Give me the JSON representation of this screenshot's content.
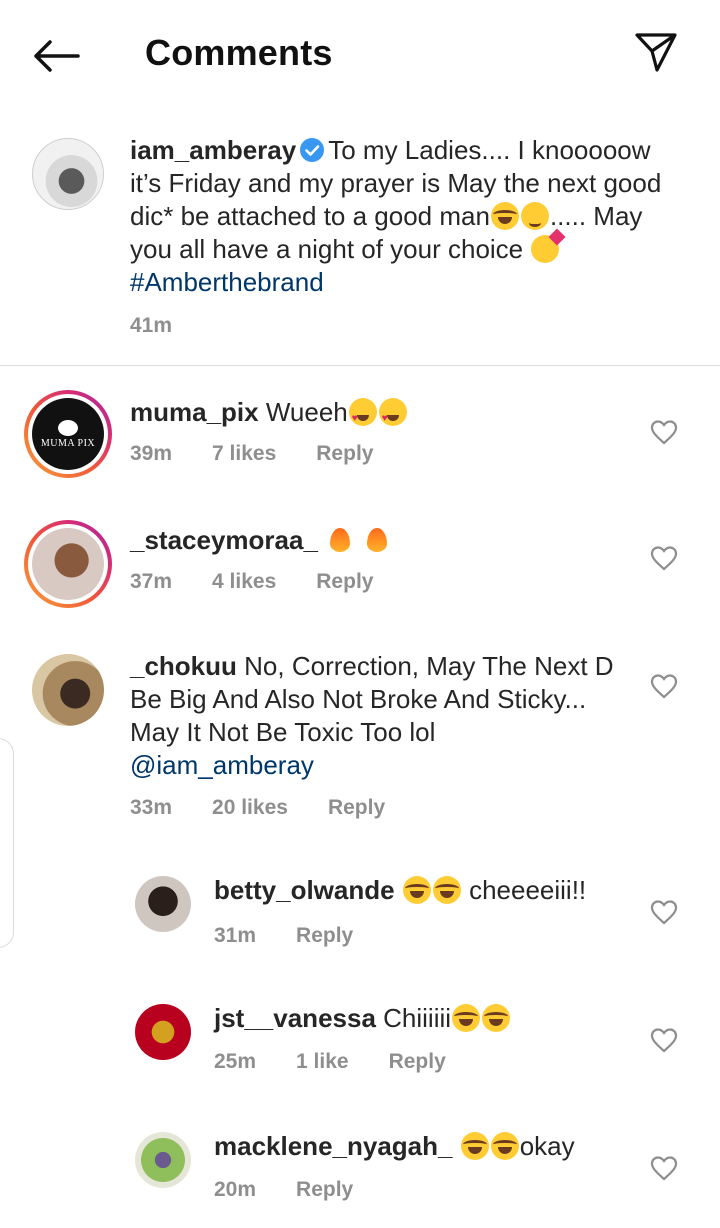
{
  "header": {
    "title": "Comments",
    "back_icon": "arrow-left-icon",
    "share_icon": "paper-plane-icon"
  },
  "caption": {
    "username": "iam_amberay",
    "verified": true,
    "text_part1": "To my Ladies.... I knooooow it’s Friday and my prayer is May the next good dic* be attached to a good man",
    "text_part2": "..... May you all have a night of your choice",
    "hashtag": "#Amberthebrand",
    "time": "41m"
  },
  "comments": [
    {
      "username": "muma_pix",
      "text": "Wueeh",
      "time": "39m",
      "likes": "7 likes",
      "reply": "Reply",
      "story_ring": true,
      "avatar_label": "MUMA PIX"
    },
    {
      "username": "_staceymoraa_",
      "text": "",
      "time": "37m",
      "likes": "4 likes",
      "reply": "Reply",
      "story_ring": true
    },
    {
      "username": "_chokuu",
      "text": "No, Correction, May The Next D Be Big And Also Not Broke And Sticky... May It Not Be Toxic Too lol",
      "mention": "@iam_amberay",
      "time": "33m",
      "likes": "20 likes",
      "reply": "Reply"
    }
  ],
  "replies": [
    {
      "username": "betty_olwande",
      "text": "cheeeeiii!!",
      "time": "31m",
      "reply": "Reply"
    },
    {
      "username": "jst__vanessa",
      "text": "Chiiiiii",
      "time": "25m",
      "likes": "1 like",
      "reply": "Reply"
    },
    {
      "username": "macklene_nyagah_",
      "text": "okay",
      "time": "20m",
      "reply": "Reply"
    }
  ],
  "colors": {
    "text": "#262626",
    "meta": "#8e8e8e",
    "link": "#00376b",
    "verified": "#3897f0",
    "divider": "#dbdbdb"
  }
}
